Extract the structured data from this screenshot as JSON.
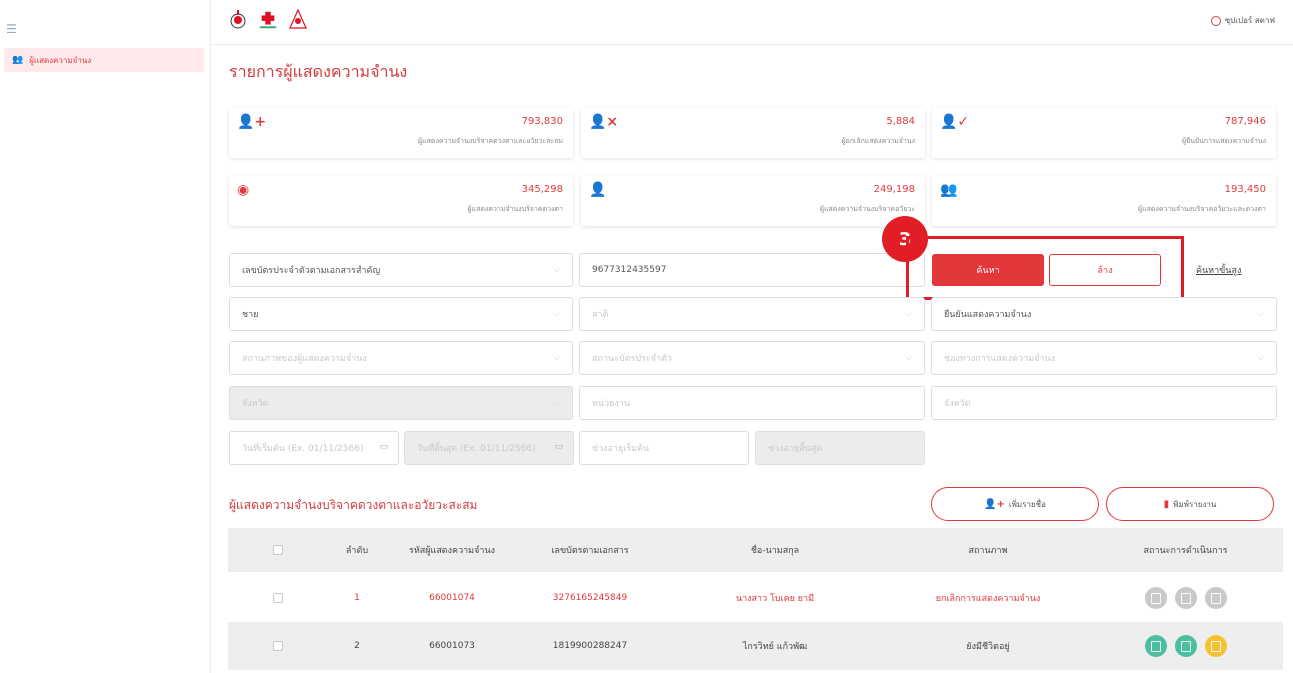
{
  "sidebar": {
    "menu_item": "ผู้แสดงความจำนง"
  },
  "header": {
    "user_name": "ซุปเปอร์ สตาฟ"
  },
  "page": {
    "title": "รายการผู้แสดงความจำนง"
  },
  "stats": [
    {
      "icon": "user-plus-icon",
      "value": "793,830",
      "caption": "ผู้แสดงความจำนงบริจาคดวงตาและอวัยวะสะสม"
    },
    {
      "icon": "user-x-icon",
      "value": "5,884",
      "caption": "ผู้ยกเลิกแสดงความจำนง"
    },
    {
      "icon": "user-check-icon",
      "value": "787,946",
      "caption": "ผู้ยืนยันการแสดงความจำนง"
    },
    {
      "icon": "eye-icon",
      "value": "345,298",
      "caption": "ผู้แสดงความจำนงบริจาคดวงตา"
    },
    {
      "icon": "user-icon",
      "value": "249,198",
      "caption": "ผู้แสดงความจำนงบริจาคอวัยวะ"
    },
    {
      "icon": "users-icon",
      "value": "193,450",
      "caption": "ผู้แสดงความจำนงบริจาคอวัยวะและดวงตา"
    }
  ],
  "filters": {
    "doc_type": "เลขบัตรประจำตัวตามเอกสารสำคัญ",
    "doc_number": "9677312435597",
    "gender": "ชาย",
    "nationality_ph": "สาติ",
    "status": "ยืนยันแสดงความจำนง",
    "donor_status_ph": "สถานภาพของผู้แสดงความจำนง",
    "card_status_ph": "สถานะบัตรประจำตัว",
    "channel_ph": "ช่องทางการแสดงความจำนง",
    "province_ph": "จังหวัด",
    "agency_ph": "หน่วยงาน",
    "region_ph": "จังหวัด",
    "date_start_ph": "วันที่เริ่มต้น (Ex. 01/11/2566)",
    "date_end_ph": "วันที่สิ้นสุด (Ex. 01/11/2566)",
    "age_start_ph": "ช่วงอายุเริ่มต้น",
    "age_end_ph": "ช่วงอายุสิ้นสุด",
    "search_label": "ค้นหา",
    "clear_label": "ล้าง",
    "advanced_label": "ค้นหาขั้นสูง"
  },
  "annotation": {
    "step": "3"
  },
  "table": {
    "title": "ผู้แสดงความจำนงบริจาคดวงตาและอวัยวะสะสม",
    "add_label": "เพิ่มรายชื่อ",
    "print_label": "พิมพ์รายงาน",
    "headers": [
      "ลำดับ",
      "รหัสผู้แสดงความจำนง",
      "เลขบัตรตามเอกสาร",
      "ชื่อ-นามสกุล",
      "สถานภาพ",
      "สถานะการดำเนินการ"
    ],
    "rows": [
      {
        "no": "1",
        "code": "66001074",
        "doc": "3276165245849",
        "name": "นางสาว โบเคย ยามี",
        "status": "ยกเลิกการแสดงความจำนง"
      },
      {
        "no": "2",
        "code": "66001073",
        "doc": "1819900288247",
        "name": "ไกรวิทย์ แก้วพัฒ",
        "status": "ยังมีชีวิตอยู่"
      }
    ]
  },
  "colors": {
    "accent": "#e4373c",
    "highlight": "#e11d25",
    "teal": "#4cbfa0",
    "yellow": "#f6c233"
  }
}
